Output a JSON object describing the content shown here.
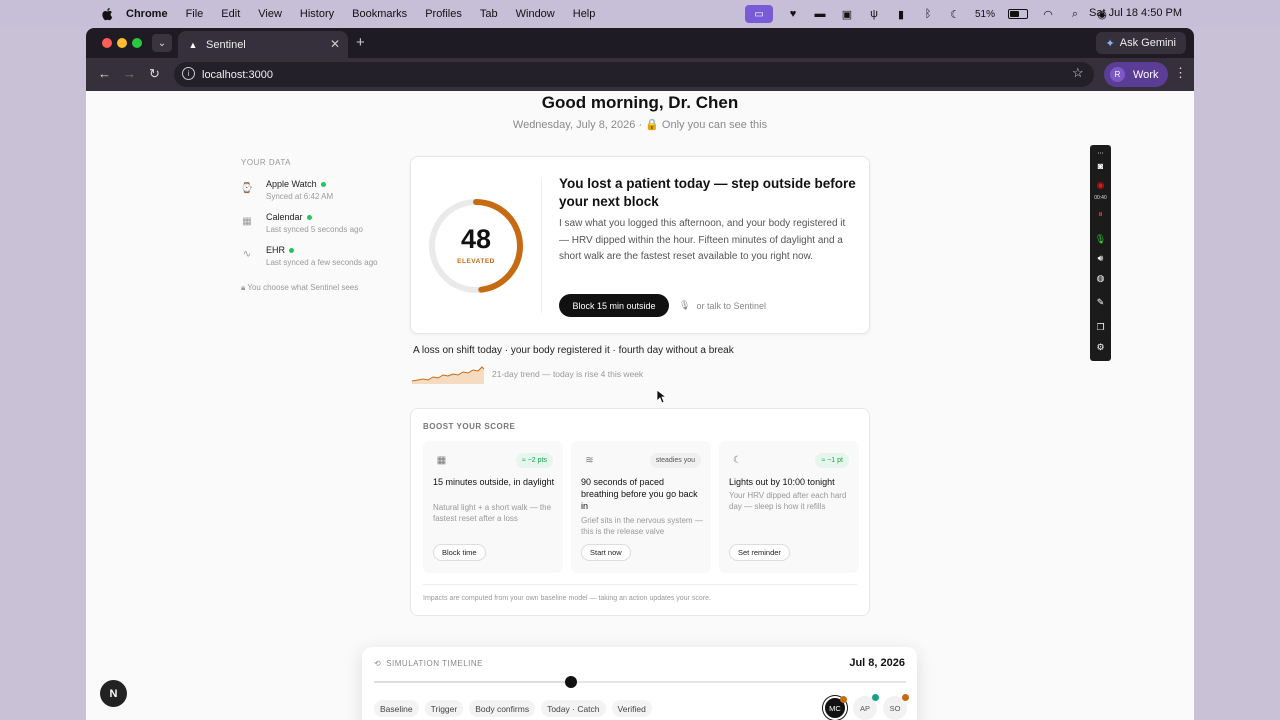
{
  "menubar": {
    "app_name": "Chrome",
    "items": [
      "File",
      "Edit",
      "View",
      "History",
      "Bookmarks",
      "Profiles",
      "Tab",
      "Window",
      "Help"
    ],
    "battery": "51%",
    "clock": "Sat Jul 18  4:50 PM"
  },
  "browser": {
    "tab_title": "Sentinel",
    "url": "localhost:3000",
    "gemini_label": "Ask Gemini",
    "profile_label": "Work",
    "profile_initial": "R"
  },
  "page": {
    "greeting": "Good morning, Dr. Chen",
    "subgreeting": "Wednesday, July 8, 2026 · 🔒 Only you can see this"
  },
  "sidebar": {
    "label": "YOUR DATA",
    "sources": [
      {
        "name": "Apple Watch",
        "sync": "Synced at 6:42 AM",
        "icon": "watch-icon"
      },
      {
        "name": "Calendar",
        "sync": "Last synced 5 seconds ago",
        "icon": "calendar-icon"
      },
      {
        "name": "EHR",
        "sync": "Last synced a few seconds ago",
        "icon": "pulse-icon"
      }
    ],
    "privacy": "You choose what Sentinel sees"
  },
  "score_card": {
    "score": "48",
    "score_value": 48,
    "level": "ELEVATED",
    "gauge_color": "#c76b12",
    "title": "You lost a patient today — step outside before your next block",
    "body": "I saw what you logged this afternoon, and your body registered it — HRV dipped within the hour. Fifteen minutes of daylight and a short walk are the fastest reset available to you right now.",
    "primary_action": "Block 15 min outside",
    "secondary_action": "or talk to Sentinel"
  },
  "context": {
    "line": "A loss on shift today · your body registered it · fourth day without a break",
    "trend_label": "21-day trend — today is rise 4 this week"
  },
  "boost": {
    "label": "BOOST YOUR SCORE",
    "actions": [
      {
        "icon": "calendar-icon",
        "impact": "≈ −2 pts",
        "impact_style": "green",
        "title": "15 minutes outside, in daylight",
        "desc": "Natural light + a short walk — the fastest reset after a loss",
        "button": "Block time"
      },
      {
        "icon": "breath-icon",
        "impact": "steadies you",
        "impact_style": "gray",
        "title": "90 seconds of paced breathing before you go back in",
        "desc": "Grief sits in the nervous system — this is the release valve",
        "button": "Start now"
      },
      {
        "icon": "moon-icon",
        "impact": "≈ −1 pt",
        "impact_style": "green",
        "title": "Lights out by 10:00 tonight",
        "desc": "Your HRV dipped after each hard day — sleep is how it refills",
        "button": "Set reminder"
      }
    ],
    "footnote": "Impacts are computed from your own baseline model — taking an action updates your score."
  },
  "timeline": {
    "label": "SIMULATION TIMELINE",
    "date": "Jul 8, 2026",
    "progress": 0.37,
    "stages": [
      "Baseline",
      "Trigger",
      "Body confirms",
      "Today · Catch",
      "Verified"
    ],
    "avatars": [
      {
        "initials": "MC",
        "active": true,
        "badge": "#c76b12"
      },
      {
        "initials": "AP",
        "active": false,
        "badge": "#16a085"
      },
      {
        "initials": "SO",
        "active": false,
        "badge": "#c76b12"
      }
    ]
  },
  "dev": {
    "badge": "N"
  },
  "recorder": {
    "time": "00:40"
  }
}
